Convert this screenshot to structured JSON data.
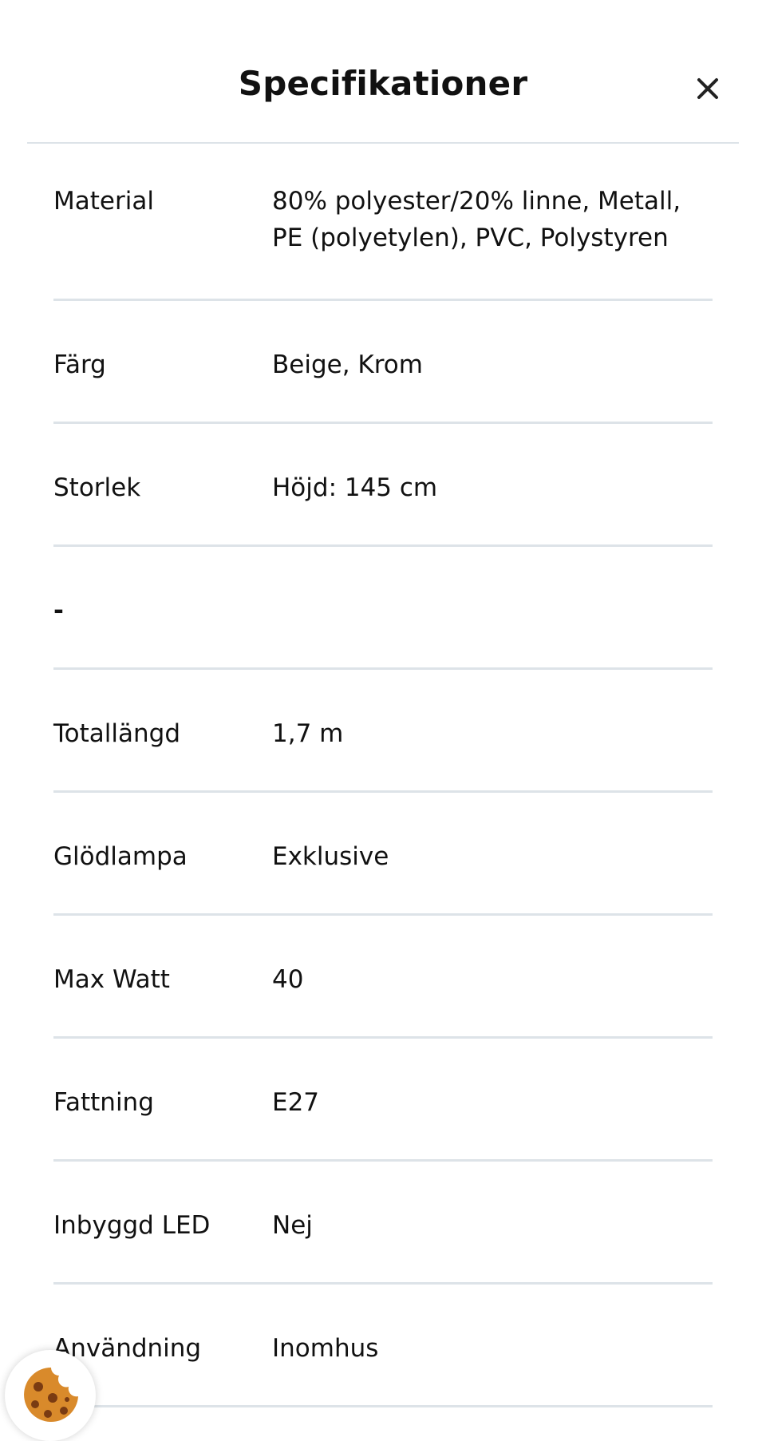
{
  "header": {
    "title": "Specifikationer",
    "close_icon": "close-icon"
  },
  "specs": [
    {
      "label": "Material",
      "value": "80% polyester/20% linne, Metall, PE (polyetylen), PVC, Polystyren"
    },
    {
      "label": "Färg",
      "value": "Beige, Krom"
    },
    {
      "label": "Storlek",
      "value": "Höjd: 145 cm"
    },
    {
      "label": "-",
      "value": ""
    },
    {
      "label": "Totallängd",
      "value": "1,7 m"
    },
    {
      "label": "Glödlampa",
      "value": "Exklusive"
    },
    {
      "label": "Max Watt",
      "value": "40"
    },
    {
      "label": "Fattning",
      "value": "E27"
    },
    {
      "label": "Inbyggd LED",
      "value": "Nej"
    },
    {
      "label": "Användning",
      "value": "Inomhus"
    }
  ],
  "cookie_button": {
    "icon": "cookie-icon"
  },
  "colors": {
    "divider": "#dde3e8",
    "text": "#111111",
    "cookie": "#d98a2b"
  }
}
